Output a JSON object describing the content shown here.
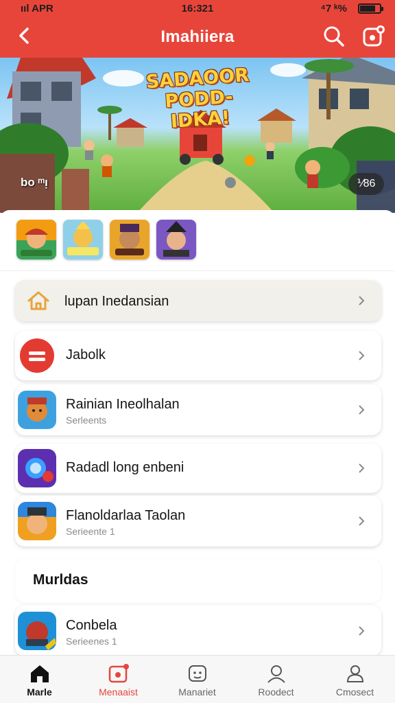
{
  "status_bar": {
    "left": "ııl APR",
    "time": "16:321",
    "right": "⁴7 ᵏ%"
  },
  "header": {
    "title": "Imahiiera"
  },
  "banner": {
    "title_line1": "SADAOOR",
    "title_line2": "PODD-IDKA!",
    "left_label": "bo ᵐᴉ",
    "badge": "⅟86"
  },
  "colors": {
    "brand": "#e8453a",
    "tab_accent": "#e5473d"
  },
  "mini_apps": [
    "mini-app-1",
    "mini-app-2",
    "mini-app-3",
    "mini-app-4"
  ],
  "list": [
    {
      "label": "lupan Inedansian",
      "icon": "home-icon"
    },
    {
      "label": "Jabolk",
      "icon": "red-circle-icon"
    },
    {
      "label": "Rainian Ineolhalan",
      "sub": "Serleents",
      "icon": "game-icon-1"
    },
    {
      "label": "Radadl long enbeni",
      "icon": "game-icon-2"
    },
    {
      "label": "Flanoldarlaa Taolan",
      "sub": "Serieente 1",
      "icon": "game-icon-3"
    }
  ],
  "section": {
    "title": "Murldas"
  },
  "section_items": [
    {
      "label": "Conbela",
      "sub": "Serieenes 1",
      "icon": "game-icon-4"
    }
  ],
  "tabs": [
    {
      "label": "Marle",
      "icon": "home-icon"
    },
    {
      "label": "Menaaist",
      "icon": "inbox-icon"
    },
    {
      "label": "Manariet",
      "icon": "face-icon"
    },
    {
      "label": "Roodect",
      "icon": "person-icon"
    },
    {
      "label": "Cmosect",
      "icon": "profile-icon"
    }
  ]
}
